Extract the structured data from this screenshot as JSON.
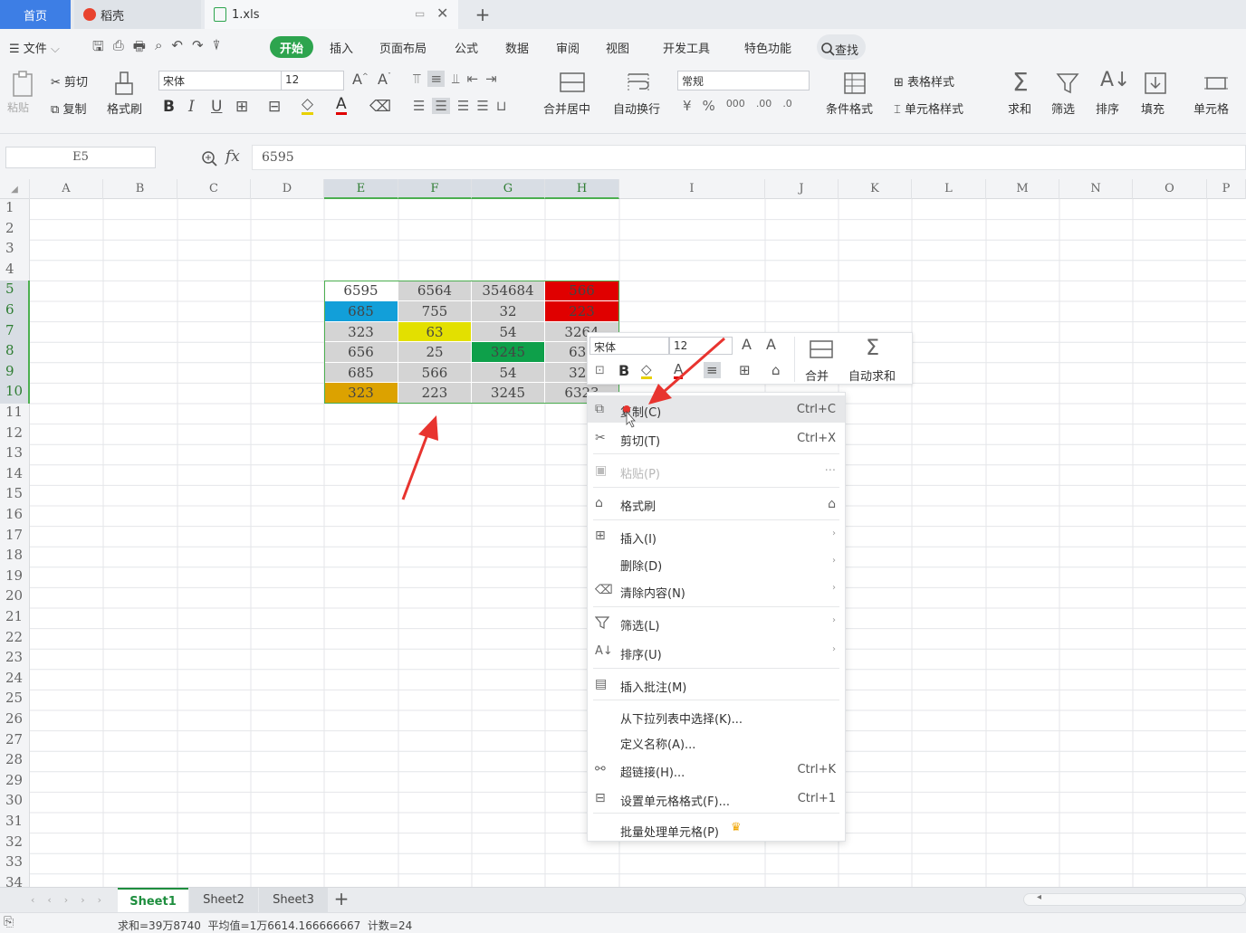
{
  "tabs": {
    "home": "首页",
    "daoke": "稻壳",
    "file": "1.xls"
  },
  "menu": {
    "file": "文件",
    "items": [
      "开始",
      "插入",
      "页面布局",
      "公式",
      "数据",
      "审阅",
      "视图",
      "开发工具",
      "特色功能"
    ],
    "search": "查找"
  },
  "ribbon": {
    "paste": "粘贴",
    "cut": "剪切",
    "copy": "复制",
    "format_painter": "格式刷",
    "font_name": "宋体",
    "font_size": "12",
    "merge_center": "合并居中",
    "wrap_text": "自动换行",
    "number_format": "常规",
    "conditional_format": "条件格式",
    "table_style": "表格样式",
    "cell_style": "单元格样式",
    "sum": "求和",
    "filter": "筛选",
    "sort": "排序",
    "fill": "填充",
    "cell": "单元格",
    "bold": "B",
    "italic": "I",
    "underline": "U"
  },
  "formula_bar": {
    "name_box": "E5",
    "fx": "fx",
    "value": "6595"
  },
  "columns": [
    "A",
    "B",
    "C",
    "D",
    "E",
    "F",
    "G",
    "H",
    "I",
    "J",
    "K",
    "L",
    "M",
    "N",
    "O",
    "P"
  ],
  "rows": [
    "1",
    "2",
    "3",
    "4",
    "5",
    "6",
    "7",
    "8",
    "9",
    "10",
    "11",
    "12",
    "13",
    "14",
    "15",
    "16",
    "17",
    "18",
    "19",
    "20",
    "21",
    "22",
    "23",
    "24",
    "25",
    "26",
    "27",
    "28",
    "29",
    "30",
    "31",
    "32",
    "33",
    "34"
  ],
  "cells": [
    {
      "col": "E",
      "row": 5,
      "value": "6595",
      "bg": "#ffffff"
    },
    {
      "col": "F",
      "row": 5,
      "value": "6564",
      "bg": "#d4d4d4"
    },
    {
      "col": "G",
      "row": 5,
      "value": "354684",
      "bg": "#d4d4d4"
    },
    {
      "col": "H",
      "row": 5,
      "value": "566",
      "bg": "#e00000"
    },
    {
      "col": "E",
      "row": 6,
      "value": "685",
      "bg": "#129fd9"
    },
    {
      "col": "F",
      "row": 6,
      "value": "755",
      "bg": "#d4d4d4"
    },
    {
      "col": "G",
      "row": 6,
      "value": "32",
      "bg": "#d4d4d4"
    },
    {
      "col": "H",
      "row": 6,
      "value": "223",
      "bg": "#e00000"
    },
    {
      "col": "E",
      "row": 7,
      "value": "323",
      "bg": "#d4d4d4"
    },
    {
      "col": "F",
      "row": 7,
      "value": "63",
      "bg": "#e3e000"
    },
    {
      "col": "G",
      "row": 7,
      "value": "54",
      "bg": "#d4d4d4"
    },
    {
      "col": "H",
      "row": 7,
      "value": "3264",
      "bg": "#d4d4d4"
    },
    {
      "col": "E",
      "row": 8,
      "value": "656",
      "bg": "#d4d4d4"
    },
    {
      "col": "F",
      "row": 8,
      "value": "25",
      "bg": "#d4d4d4"
    },
    {
      "col": "G",
      "row": 8,
      "value": "3245",
      "bg": "#0ea04a"
    },
    {
      "col": "H",
      "row": 8,
      "value": "632",
      "bg": "#d4d4d4"
    },
    {
      "col": "E",
      "row": 9,
      "value": "685",
      "bg": "#d4d4d4"
    },
    {
      "col": "F",
      "row": 9,
      "value": "566",
      "bg": "#d4d4d4"
    },
    {
      "col": "G",
      "row": 9,
      "value": "54",
      "bg": "#d4d4d4"
    },
    {
      "col": "H",
      "row": 9,
      "value": "326",
      "bg": "#d4d4d4"
    },
    {
      "col": "E",
      "row": 10,
      "value": "323",
      "bg": "#dca200"
    },
    {
      "col": "F",
      "row": 10,
      "value": "223",
      "bg": "#d4d4d4"
    },
    {
      "col": "G",
      "row": 10,
      "value": "3245",
      "bg": "#d4d4d4"
    },
    {
      "col": "H",
      "row": 10,
      "value": "6323",
      "bg": "#d4d4d4"
    }
  ],
  "mini_toolbar": {
    "font_name": "宋体",
    "font_size": "12",
    "bold": "B",
    "merge": "合并",
    "autosum": "自动求和"
  },
  "context_menu": {
    "copy": "复制(C)",
    "copy_sc": "Ctrl+C",
    "cut": "剪切(T)",
    "cut_sc": "Ctrl+X",
    "paste": "粘贴(P)",
    "paste_more": "···",
    "format_painter": "格式刷",
    "insert": "插入(I)",
    "delete": "删除(D)",
    "clear": "清除内容(N)",
    "filter": "筛选(L)",
    "sort": "排序(U)",
    "comment": "插入批注(M)",
    "pick_list": "从下拉列表中选择(K)...",
    "define_name": "定义名称(A)...",
    "hyperlink": "超链接(H)...",
    "hyperlink_sc": "Ctrl+K",
    "format_cells": "设置单元格格式(F)...",
    "format_cells_sc": "Ctrl+1",
    "batch": "批量处理单元格(P)"
  },
  "sheets": [
    "Sheet1",
    "Sheet2",
    "Sheet3"
  ],
  "status": {
    "sum": "求和=39万8740",
    "avg": "平均值=1万6614.166666667",
    "count": "计数=24"
  },
  "colors": {
    "accent_green": "#2da44e",
    "tab_blue": "#3d7ee5",
    "arrow_red": "#e8342f"
  }
}
